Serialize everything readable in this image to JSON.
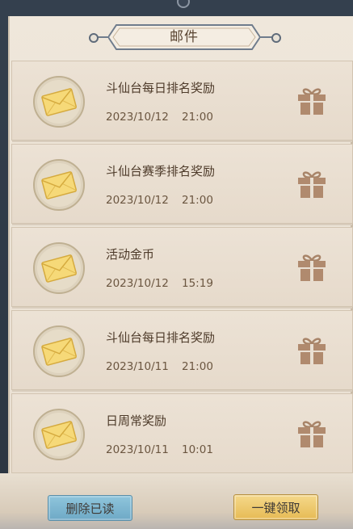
{
  "header": {
    "title": "邮件"
  },
  "mails": [
    {
      "subject": "斗仙台每日排名奖励",
      "date": "2023/10/12",
      "time": "21:00"
    },
    {
      "subject": "斗仙台赛季排名奖励",
      "date": "2023/10/12",
      "time": "21:00"
    },
    {
      "subject": "活动金币",
      "date": "2023/10/12",
      "time": "15:19"
    },
    {
      "subject": "斗仙台每日排名奖励",
      "date": "2023/10/11",
      "time": "21:00"
    },
    {
      "subject": "日周常奖励",
      "date": "2023/10/11",
      "time": "10:01"
    }
  ],
  "footer": {
    "delete_read_label": "删除已读",
    "claim_all_label": "一键领取"
  },
  "icons": {
    "envelope": "envelope-icon",
    "gift": "gift-icon"
  },
  "colors": {
    "panel_bg": "#ece2d5",
    "envelope_yellow": "#f3d26a",
    "gift_brown": "#b08a6e",
    "delete_button": "#7fb7d1",
    "claim_button": "#eec76b"
  }
}
